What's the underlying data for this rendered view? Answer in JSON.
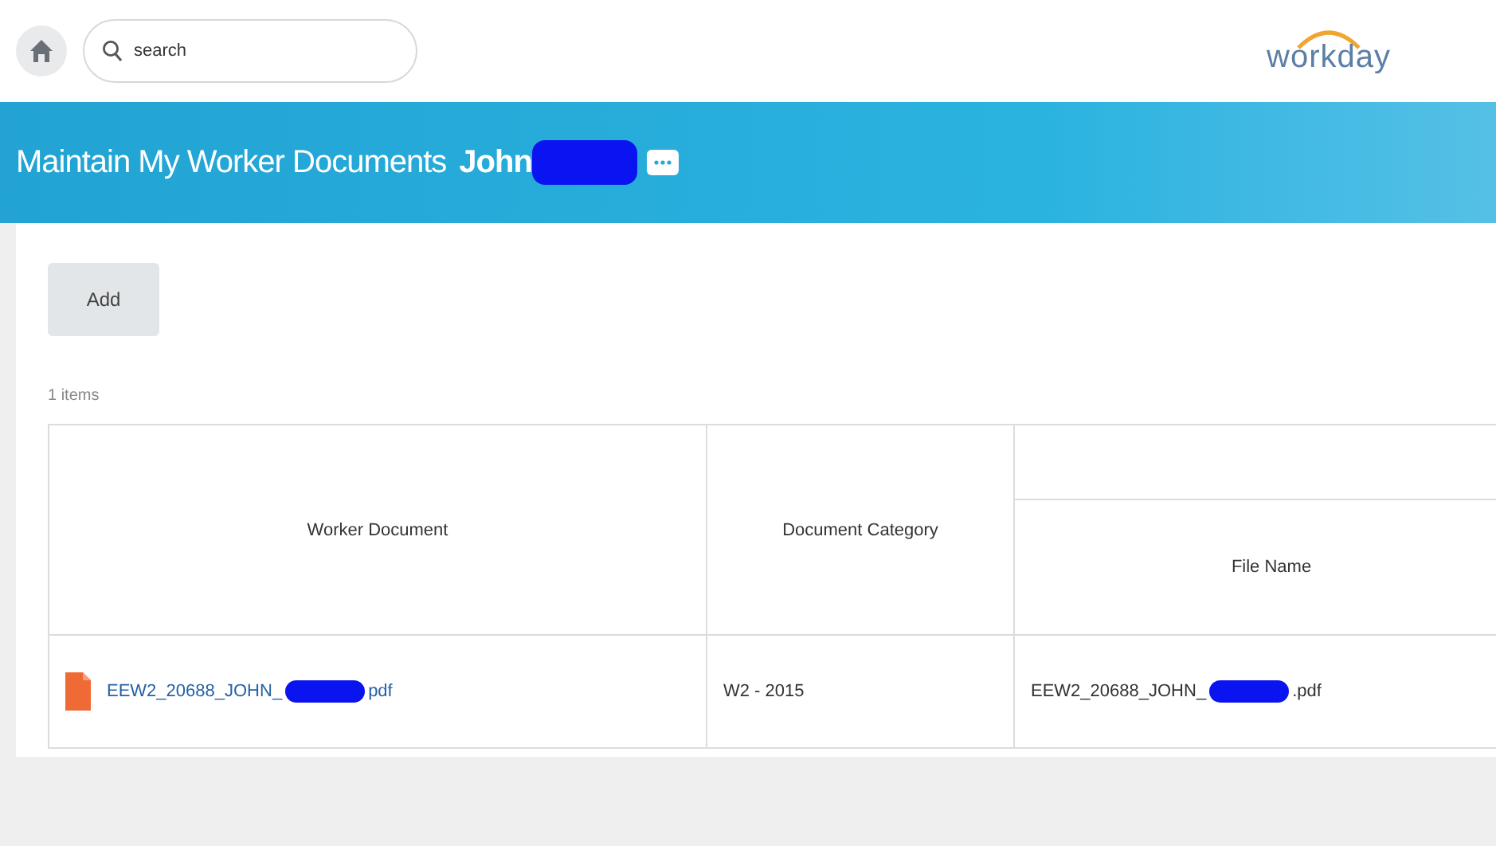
{
  "topbar": {
    "search": {
      "placeholder": "search"
    },
    "logo": "workday"
  },
  "header": {
    "title": "Maintain My Worker Documents",
    "worker": "John"
  },
  "actions": {
    "add": "Add"
  },
  "count": "1 items",
  "table": {
    "columns": [
      {
        "label": "Worker Document"
      },
      {
        "label": "Document Category"
      },
      {
        "label": "File Name"
      }
    ],
    "rows": [
      {
        "document": {
          "start": "EEW2_20688_JOHN_",
          "end": "pdf"
        },
        "category": "W2 - 2015",
        "file_name": {
          "start": "EEW2_20688_JOHN_",
          "end": ".pdf"
        }
      }
    ]
  }
}
